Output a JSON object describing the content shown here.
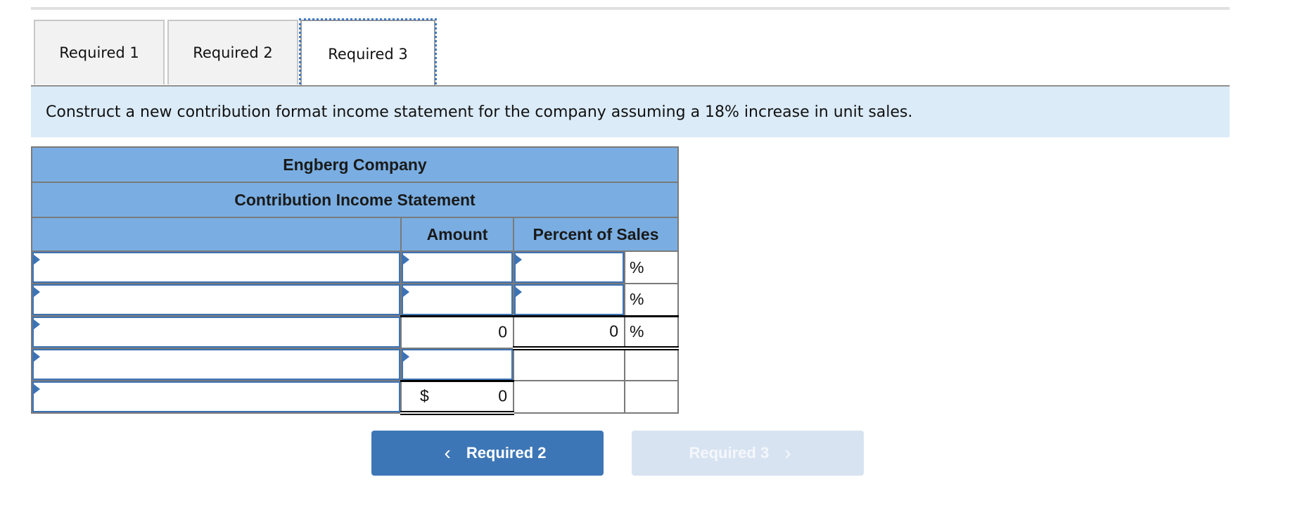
{
  "tabs": [
    {
      "label": "Required 1",
      "active": false
    },
    {
      "label": "Required 2",
      "active": false
    },
    {
      "label": "Required 3",
      "active": true
    }
  ],
  "instruction": "Construct a new contribution format income statement for the company assuming a 18% increase in unit sales.",
  "statement": {
    "company": "Engberg Company",
    "title": "Contribution Income Statement",
    "columns": {
      "amount": "Amount",
      "percent": "Percent of Sales"
    },
    "rows": [
      {
        "label": "",
        "amount": "",
        "percent": "",
        "percent_symbol": "%"
      },
      {
        "label": "",
        "amount": "",
        "percent": "",
        "percent_symbol": "%"
      },
      {
        "label": "",
        "amount": "0",
        "percent": "0",
        "percent_symbol": "%"
      },
      {
        "label": "",
        "amount": "",
        "percent": "",
        "percent_symbol": ""
      },
      {
        "label": "",
        "currency": "$",
        "amount": "0",
        "percent": "",
        "percent_symbol": ""
      }
    ]
  },
  "navigation": {
    "prev_label": "Required 2",
    "next_label": "Required 3",
    "prev_icon": "chevron-left-icon",
    "next_icon": "chevron-right-icon"
  },
  "colors": {
    "header_blue": "#7aaee2",
    "input_border": "#3d73b5",
    "prev_button": "#3d76b6",
    "next_button_disabled": "#d8e3f1",
    "instruction_bg": "#dbebf8"
  }
}
